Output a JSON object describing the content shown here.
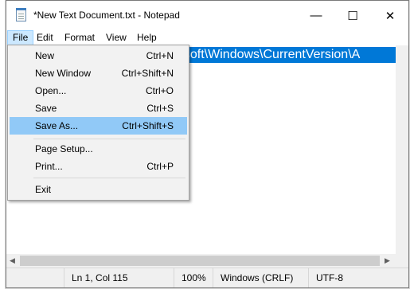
{
  "window": {
    "title": "*New Text Document.txt - Notepad",
    "controls": {
      "minimize": "—",
      "maximize": "☐",
      "close": "✕"
    }
  },
  "menubar": [
    "File",
    "Edit",
    "Format",
    "View",
    "Help"
  ],
  "editor": {
    "visible_text": "osoft\\Windows\\CurrentVersion\\A",
    "selection_color": "#0078d7"
  },
  "file_menu": {
    "items": [
      {
        "label": "New",
        "shortcut": "Ctrl+N"
      },
      {
        "label": "New Window",
        "shortcut": "Ctrl+Shift+N"
      },
      {
        "label": "Open...",
        "shortcut": "Ctrl+O"
      },
      {
        "label": "Save",
        "shortcut": "Ctrl+S"
      },
      {
        "label": "Save As...",
        "shortcut": "Ctrl+Shift+S"
      },
      {
        "label": "Page Setup...",
        "shortcut": ""
      },
      {
        "label": "Print...",
        "shortcut": "Ctrl+P"
      },
      {
        "label": "Exit",
        "shortcut": ""
      }
    ],
    "highlighted": "Save As..."
  },
  "statusbar": {
    "position": "Ln 1, Col 115",
    "zoom": "100%",
    "line_ending": "Windows (CRLF)",
    "encoding": "UTF-8"
  }
}
